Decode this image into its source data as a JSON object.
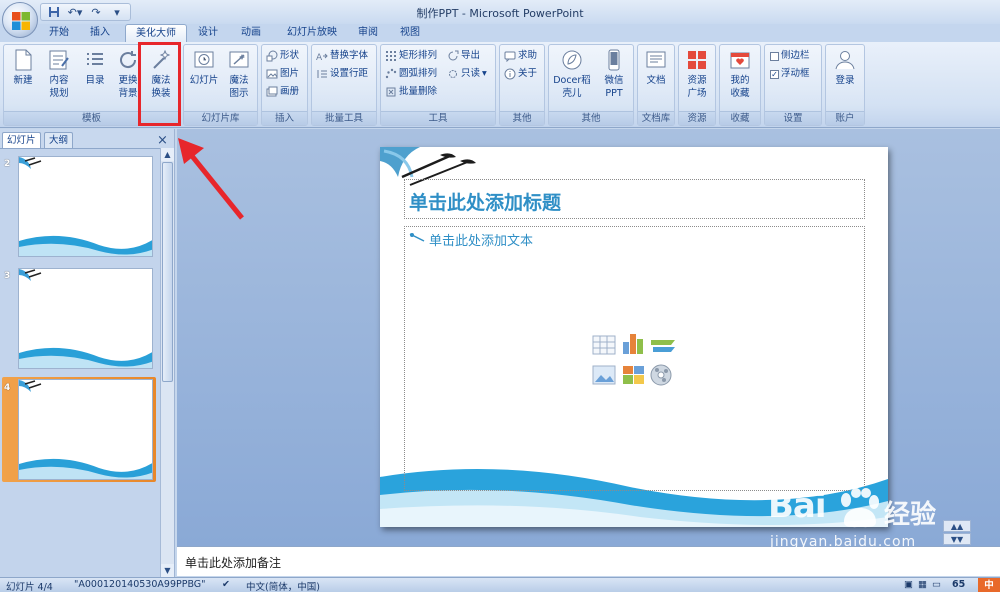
{
  "window": {
    "title": "制作PPT - Microsoft PowerPoint"
  },
  "tabs": [
    "开始",
    "插入",
    "美化大师",
    "设计",
    "动画",
    "幻灯片放映",
    "审阅",
    "视图"
  ],
  "active_tab": "美化大师",
  "ribbon": {
    "groups": {
      "template": {
        "label": "模板",
        "buttons": [
          "新建",
          "内容\n规划",
          "目录",
          "更换\n背景",
          "魔法\n换装"
        ]
      },
      "slide_lib": {
        "label": "幻灯片库",
        "buttons": [
          "幻灯片",
          "魔法\n图示"
        ]
      },
      "insert": {
        "label": "插入",
        "buttons": [
          "形状",
          "图片",
          "画册"
        ]
      },
      "batch": {
        "label": "批量工具",
        "buttons": [
          "替换字体",
          "设置行距"
        ]
      },
      "tools": {
        "label": "工具",
        "buttons": [
          "矩形排列",
          "导出",
          "圆弧排列",
          "只读",
          "批量删除"
        ]
      },
      "other1": {
        "label": "其他",
        "buttons": [
          "求助",
          "关于"
        ]
      },
      "other2": {
        "label": "其他",
        "buttons": [
          "Docer稻\n壳儿",
          "微信\nPPT"
        ]
      },
      "doclib": {
        "label": "文档库",
        "buttons": [
          "文档"
        ]
      },
      "resources": {
        "label": "资源",
        "buttons": [
          "资源\n广场"
        ]
      },
      "favorites": {
        "label": "收藏",
        "buttons": [
          "我的\n收藏"
        ]
      },
      "settings": {
        "label": "设置",
        "buttons": [
          "侧边栏",
          "浮动框"
        ]
      },
      "account": {
        "label": "账户",
        "buttons": [
          "登录"
        ]
      }
    }
  },
  "left_panel": {
    "tabs": [
      "幻灯片",
      "大纲"
    ],
    "close": "×",
    "slides": [
      "2",
      "3",
      "4"
    ],
    "selected_slide": "4"
  },
  "slide": {
    "title_placeholder": "单击此处添加标题",
    "body_placeholder": "单击此处添加文本"
  },
  "notes": {
    "placeholder": "单击此处添加备注"
  },
  "status": {
    "slide_info": "幻灯片 4/4",
    "theme": "\"A000120140530A99PPBG\"",
    "language": "中文(简体，中国)",
    "zoom": "65"
  },
  "watermark": {
    "brand": "Bai",
    "brand_cn": "经验",
    "url": "jingyan.baidu.com"
  },
  "colors": {
    "accent": "#2f8fc6",
    "highlight": "#e7262b",
    "selection": "#e8872a"
  }
}
